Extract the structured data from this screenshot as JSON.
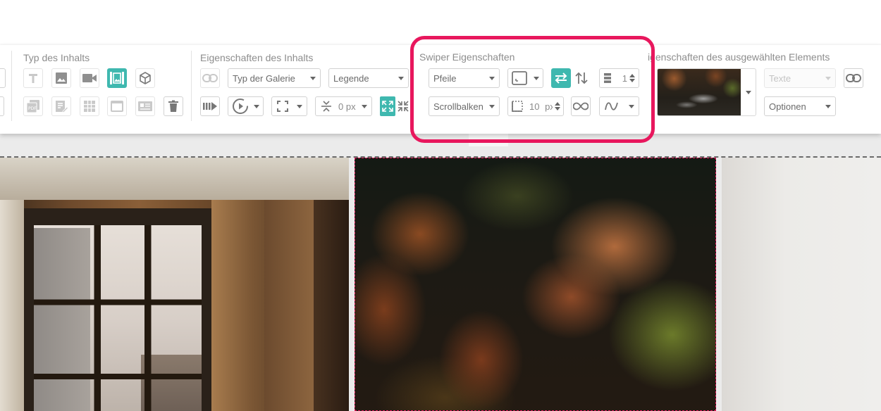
{
  "sections": {
    "content_type": {
      "title": "Typ des Inhalts"
    },
    "content_props": {
      "title": "Eigenschaften des Inhalts",
      "gallery_type": "Typ der Galerie",
      "legend": "Legende",
      "gap_value": "0",
      "gap_unit": "px"
    },
    "swiper": {
      "title": "Swiper Eigenschaften",
      "arrows": "Pfeile",
      "scrollbar": "Scrollbalken",
      "slides_per_view": "1",
      "space_value": "10",
      "space_unit": "px"
    },
    "selected": {
      "title": "igenschaften des ausgewählten Elements",
      "texts": "Texte",
      "options": "Optionen"
    }
  },
  "colors": {
    "accent": "#3fb8af",
    "highlight": "#e8175d",
    "icon_gray": "#8f8f8f",
    "icon_dim": "#c9c9c9"
  },
  "icons": [
    "text-icon",
    "image-icon",
    "video-icon",
    "gallery-icon",
    "3d-box-icon",
    "pdf-icon",
    "form-icon",
    "table-icon",
    "frame-icon",
    "contact-card-icon",
    "trash-icon",
    "link-icon",
    "autoplay-icon",
    "play-circle-icon",
    "fullscreen-icon",
    "gap-icon",
    "expand-icon",
    "collapse-icon",
    "border-box-icon",
    "horizontal-swap-icon",
    "vertical-swap-icon",
    "slides-icon",
    "dotted-square-icon",
    "infinity-icon",
    "wave-icon"
  ]
}
